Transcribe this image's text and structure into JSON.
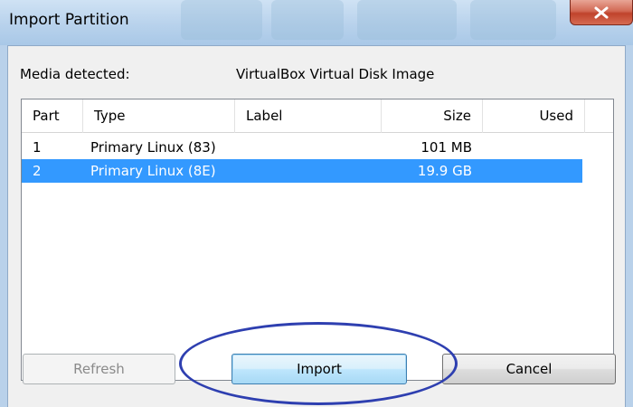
{
  "window": {
    "title": "Import Partition",
    "close_icon": "close-icon"
  },
  "media": {
    "label": "Media detected:",
    "value": "VirtualBox Virtual Disk Image"
  },
  "table": {
    "columns": [
      "Part",
      "Type",
      "Label",
      "Size",
      "Used"
    ],
    "rows": [
      {
        "part": "1",
        "type": "Primary Linux (83)",
        "label": "",
        "size": "101 MB",
        "used": "",
        "selected": false
      },
      {
        "part": "2",
        "type": "Primary Linux (8E)",
        "label": "",
        "size": "19.9 GB",
        "used": "",
        "selected": true
      }
    ]
  },
  "buttons": {
    "refresh": "Refresh",
    "import": "Import",
    "cancel": "Cancel"
  },
  "colors": {
    "selection": "#3399ff",
    "annotation": "#2e3fb0"
  }
}
